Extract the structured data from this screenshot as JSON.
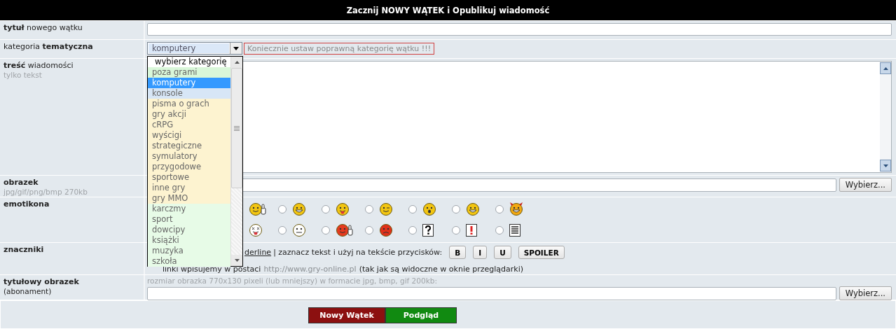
{
  "header": {
    "title": "Zacznij NOWY WĄTEK i Opublikuj wiadomość"
  },
  "rows": [
    {
      "kind": "text",
      "label": "**tytuł** nowego wątku",
      "strong": false
    },
    {
      "kind": "select",
      "label": "kategoria **tematyczna**",
      "strong": false,
      "select": {
        "value": "komputery",
        "expanded": true,
        "options": [
          {
            "label": "wybierz kategorię",
            "selected": false,
            "color": "#ffffff"
          },
          {
            "label": "poza grami",
            "selected": false,
            "color": "#d9f7d9"
          },
          {
            "label": "komputery",
            "selected": true,
            "color": "#3399ff"
          },
          {
            "label": "konsole",
            "selected": false,
            "color": "#d7e6f6"
          },
          {
            "label": "pisma o grach",
            "selected": false,
            "color": "#fdf3d0"
          },
          {
            "label": "gry akcji",
            "selected": false,
            "color": "#fdf3d0"
          },
          {
            "label": "cRPG",
            "selected": false,
            "color": "#fdf3d0"
          },
          {
            "label": "wyścigi",
            "selected": false,
            "color": "#fdf3d0"
          },
          {
            "label": "strategiczne",
            "selected": false,
            "color": "#fdf3d0"
          },
          {
            "label": "symulatory",
            "selected": false,
            "color": "#fdf3d0"
          },
          {
            "label": "przygodowe",
            "selected": false,
            "color": "#fdf3d0"
          },
          {
            "label": "sportowe",
            "selected": false,
            "color": "#fdf3d0"
          },
          {
            "label": "inne gry",
            "selected": false,
            "color": "#fdf3d0"
          },
          {
            "label": "gry MMO",
            "selected": false,
            "color": "#fdf3d0"
          },
          {
            "label": "karczmy",
            "selected": false,
            "color": "#e7fbe7"
          },
          {
            "label": "sport",
            "selected": false,
            "color": "#e7fbe7"
          },
          {
            "label": "dowcipy",
            "selected": false,
            "color": "#e7fbe7"
          },
          {
            "label": "książki",
            "selected": false,
            "color": "#e7fbe7"
          },
          {
            "label": "muzyka",
            "selected": false,
            "color": "#e7fbe7"
          },
          {
            "label": "szkoła",
            "selected": false,
            "color": "#e7fbe7"
          }
        ]
      },
      "warning": "Koniecznie ustaw poprawną kategorię wątku !!!"
    },
    {
      "kind": "textarea",
      "label": "**treść** wiadomości",
      "strong": false,
      "note": "tylko tekst",
      "note_muted": true
    },
    {
      "kind": "file",
      "label": "obrazek",
      "strong": true,
      "note": "jpg/gif/png/bmp 270kb",
      "note_muted": true,
      "button": "Wybierz..."
    },
    {
      "kind": "emoticons",
      "label": "emotikona",
      "strong": true,
      "emoticons": [
        [
          {
            "kind": "bare"
          },
          {
            "kind": "choice",
            "selected": false
          },
          {
            "kind": "choice",
            "selected": false
          },
          {
            "kind": "choice",
            "selected": false
          },
          {
            "kind": "choice",
            "selected": false
          },
          {
            "kind": "choice",
            "selected": false
          },
          {
            "kind": "choice",
            "selected": false
          }
        ],
        [
          {
            "kind": "bare"
          },
          {
            "kind": "choice",
            "selected": false
          },
          {
            "kind": "choice",
            "selected": false
          },
          {
            "kind": "choice",
            "selected": false
          },
          {
            "kind": "choice",
            "selected": false
          },
          {
            "kind": "choice",
            "selected": false
          },
          {
            "kind": "choice",
            "selected": false
          }
        ]
      ]
    },
    {
      "kind": "tags",
      "label": "znaczniki",
      "strong": true,
      "link": "derline",
      "text": "| zaznacz tekst i użyj na tekście przycisków:",
      "buttons": [
        "B",
        "I",
        "U",
        "SPOILER"
      ],
      "line2": {
        "before": "linki wpisujemy w postaci",
        "url": "http://www.gry-online.pl",
        "after": "(tak jak są widoczne w oknie przeglądarki)"
      }
    },
    {
      "kind": "file",
      "label": "tytułowy obrazek",
      "strong": true,
      "note": "(abonament)",
      "note_muted": false,
      "hint": "rozmiar obrazka 770x130 pixeli (lub mniejszy) w formacie jpg, bmp, gif 200kb:",
      "button": "Wybierz..."
    }
  ],
  "actions": [
    {
      "label": "Nowy Wątek",
      "kind": "submit"
    },
    {
      "label": "Podgląd",
      "kind": "preview"
    }
  ]
}
